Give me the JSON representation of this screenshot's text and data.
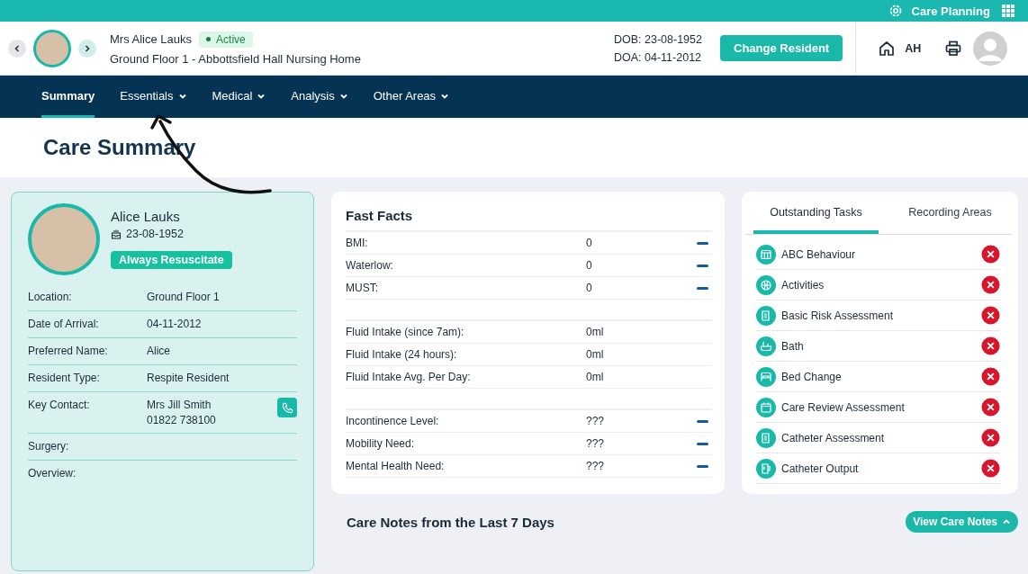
{
  "top_bar": {
    "app_name": "Care Planning"
  },
  "resident_header": {
    "name": "Mrs Alice Lauks",
    "status": "Active",
    "location": "Ground Floor 1 - Abbottsfield Hall Nursing Home",
    "dob": "DOB: 23-08-1952",
    "doa": "DOA: 04-11-2012",
    "change_button": "Change Resident",
    "user_initials": "AH"
  },
  "nav": [
    {
      "label": "Summary",
      "selected": true,
      "dropdown": false
    },
    {
      "label": "Essentials",
      "selected": false,
      "dropdown": true
    },
    {
      "label": "Medical",
      "selected": false,
      "dropdown": true
    },
    {
      "label": "Analysis",
      "selected": false,
      "dropdown": true
    },
    {
      "label": "Other Areas",
      "selected": false,
      "dropdown": true
    }
  ],
  "page_title": "Care Summary",
  "profile": {
    "name": "Alice Lauks",
    "dob": "23-08-1952",
    "badge": "Always Resuscitate",
    "fields": [
      {
        "label": "Location:",
        "lines": [
          "Ground Floor 1"
        ],
        "kind": "text"
      },
      {
        "label": "Date of Arrival:",
        "lines": [
          "04-11-2012"
        ],
        "kind": "text"
      },
      {
        "label": "Preferred Name:",
        "lines": [
          "Alice"
        ],
        "kind": "text"
      },
      {
        "label": "Resident Type:",
        "lines": [
          "Respite Resident"
        ],
        "kind": "text"
      },
      {
        "label": "Key Contact:",
        "lines": [
          "Mrs Jill Smith",
          "01822 738100"
        ],
        "kind": "contact"
      },
      {
        "label": "Surgery:",
        "kind": "text"
      },
      {
        "label": "Overview:",
        "kind": "text"
      }
    ]
  },
  "fast_facts": {
    "title": "Fast Facts",
    "groups": [
      [
        {
          "label": "BMI:",
          "value": "0",
          "kind": "scored"
        },
        {
          "label": "Waterlow:",
          "value": "0",
          "kind": "scored"
        },
        {
          "label": "MUST:",
          "value": "0",
          "kind": "scored"
        }
      ],
      [
        {
          "label": "Fluid Intake (since 7am):",
          "value": "0ml",
          "kind": "plain"
        },
        {
          "label": "Fluid Intake (24 hours):",
          "value": "0ml",
          "kind": "plain"
        },
        {
          "label": "Fluid Intake Avg. Per Day:",
          "value": "0ml",
          "kind": "plain"
        }
      ],
      [
        {
          "label": "Incontinence Level:",
          "value": "???",
          "kind": "scored"
        },
        {
          "label": "Mobility Need:",
          "value": "???",
          "kind": "scored"
        },
        {
          "label": "Mental Health Need:",
          "value": "???",
          "kind": "scored"
        }
      ]
    ]
  },
  "task_tabs": [
    {
      "label": "Outstanding Tasks",
      "selected": true
    },
    {
      "label": "Recording Areas",
      "selected": false
    }
  ],
  "tasks": [
    {
      "label": "ABC Behaviour",
      "kind": "table"
    },
    {
      "label": "Activities",
      "kind": "ball"
    },
    {
      "label": "Basic Risk Assessment",
      "kind": "document"
    },
    {
      "label": "Bath",
      "kind": "bath"
    },
    {
      "label": "Bed Change",
      "kind": "bed"
    },
    {
      "label": "Care Review Assessment",
      "kind": "calendar"
    },
    {
      "label": "Catheter Assessment",
      "kind": "document"
    },
    {
      "label": "Catheter Output",
      "kind": "cup"
    }
  ],
  "care_notes": {
    "title": "Care Notes from the Last 7 Days",
    "button": "View Care Notes"
  }
}
